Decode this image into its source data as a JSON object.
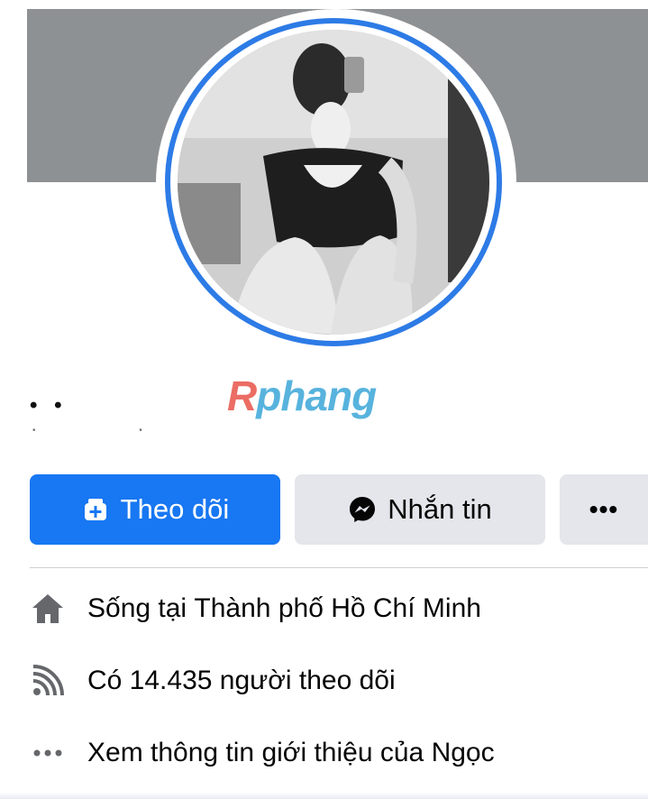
{
  "profile": {
    "name_masked": "• •",
    "watermark": "Rphang"
  },
  "actions": {
    "follow_label": "Theo dõi",
    "message_label": "Nhắn tin",
    "more_label": "•••"
  },
  "intro": {
    "lives_prefix": "Sống tại ",
    "lives_city": "Thành phố Hồ Chí Minh",
    "followers_text": "Có 14.435 người theo dõi",
    "about_text": "Xem thông tin giới thiệu của Ngọc"
  },
  "colors": {
    "primary": "#1877f2",
    "secondary_button": "#e4e6eb",
    "cover": "#8e9194",
    "avatar_ring": "#2d7be6"
  }
}
